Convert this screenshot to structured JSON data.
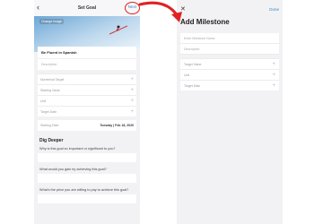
{
  "left": {
    "nav": {
      "back": "‹",
      "title": "Set Goal",
      "next": "Next"
    },
    "hero": {
      "tag": "Change Image"
    },
    "goal_name": "Be Fluent in Spanish",
    "description_placeholder": "Description",
    "fields": [
      {
        "label": "Numerical Target"
      },
      {
        "label": "Starting Value"
      },
      {
        "label": "Unit"
      },
      {
        "label": "Target Date"
      }
    ],
    "starting_date": {
      "label": "Starting Date",
      "value": "Tuesday | Feb 18, 2020"
    },
    "dig_deeper": {
      "title": "Dig Deeper",
      "questions": [
        "Why is this goal so important or significant to you?",
        "What would you gain by achieving this goal?",
        "What's the price you are willing to pay to achieve this goal?"
      ]
    }
  },
  "right": {
    "nav": {
      "close": "✕",
      "done": "Done"
    },
    "title": "Add Milestone",
    "name_placeholder": "Enter Milestone Name",
    "description_placeholder": "Description",
    "fields": [
      {
        "label": "Target Value"
      },
      {
        "label": "Unit"
      },
      {
        "label": "Target Date"
      }
    ]
  },
  "colors": {
    "accent": "#3b82c4",
    "annotation": "#e02222",
    "hero_sky": "#6ea7d6"
  }
}
